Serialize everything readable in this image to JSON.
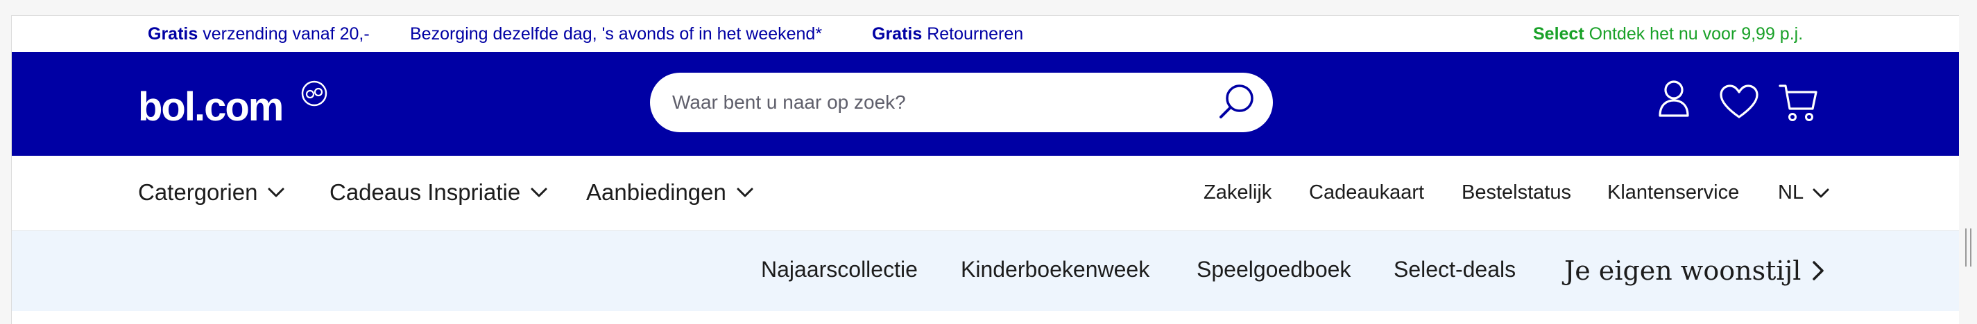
{
  "promo": {
    "shipping": {
      "bold": "Gratis",
      "text": " verzending vanaf 20,-"
    },
    "delivery": {
      "text": "Bezorging dezelfde dag, 's avonds of in het weekend*"
    },
    "returns": {
      "bold": "Gratis",
      "text": " Retourneren"
    },
    "select": {
      "bold": "Select",
      "text": " Ontdek het nu voor 9,99 p.j."
    }
  },
  "header": {
    "logo_text": "bol.com",
    "search_placeholder": "Waar bent u naar op zoek?",
    "icons": [
      "user-icon",
      "heart-icon",
      "cart-icon"
    ]
  },
  "nav": {
    "left": [
      "Catergorien",
      "Cadeaus Inspriatie",
      "Aanbiedingen"
    ],
    "right": [
      "Zakelijk",
      "Cadeaukaart",
      "Bestelstatus",
      "Klantenservice",
      "NL"
    ]
  },
  "subnav": {
    "items": [
      "Najaarscollectie",
      "Kinderboekenweek",
      "Speelgoedboek",
      "Select-deals"
    ],
    "feature": "Je eigen woonstijl"
  },
  "colors": {
    "brand_blue": "#0000a4",
    "select_green": "#19a128",
    "subnav_bg": "#eef5fd"
  }
}
